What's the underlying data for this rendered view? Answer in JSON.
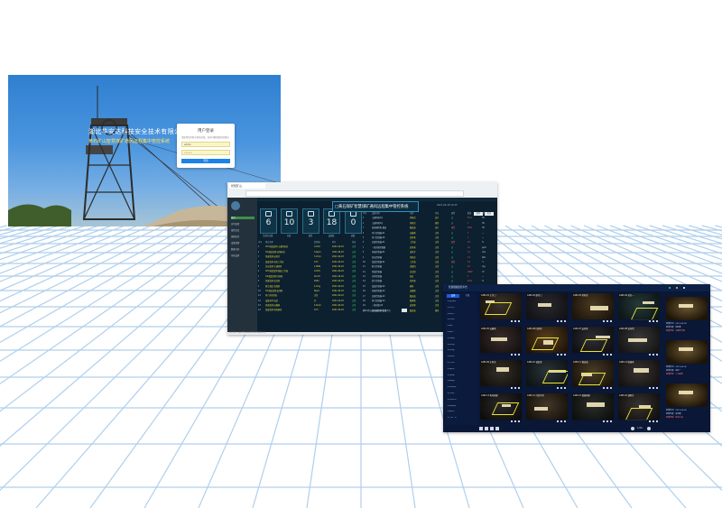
{
  "login": {
    "company": "湖北华安达科技安全技术有限公司",
    "system": "黄石矿山智慧煤矿通风远程集中管控系统",
    "card_title": "用户登录",
    "hint": "请使用您的账号登录系统，如有问题请联系管理员",
    "username_value": "admin",
    "password_value": "••••••",
    "login_button": "登录"
  },
  "dashboard": {
    "browser_tab": "智慧矿山",
    "title": "□黄石煤矿智慧煤矿通风远程集中管控系统",
    "date": "2021-06-18 10:25",
    "toggles": [
      "实时",
      "历史"
    ],
    "side_items": [
      "首页",
      "实时监测",
      "报警信息",
      "视频监控",
      "设备管理",
      "数据分析",
      "系统设置"
    ],
    "kpis": [
      {
        "value": "6",
        "label": "监测点总数"
      },
      {
        "value": "10",
        "label": "在线"
      },
      {
        "value": "3",
        "label": "报警"
      },
      {
        "value": "18",
        "label": "设备数"
      },
      {
        "value": "0",
        "label": "故障"
      }
    ],
    "left_table": {
      "headers": [
        "序号",
        "测点名称",
        "监测值",
        "时间",
        "状态"
      ],
      "rows": [
        [
          "1",
          "CH4浓度监测-主通风机房",
          "0.02%",
          "2021-06-18",
          "正常"
        ],
        [
          "2",
          "CO浓度监测-回风巷道",
          "12ppm",
          "2021-06-18",
          "正常"
        ],
        [
          "3",
          "风速监测-进风井",
          "3.2m/s",
          "2021-06-18",
          "正常"
        ],
        [
          "4",
          "温度监测-采区工作面",
          "24℃",
          "2021-06-18",
          "正常"
        ],
        [
          "5",
          "负压监测-主通风机",
          "1.8kPa",
          "2021-06-18",
          "正常"
        ],
        [
          "6",
          "CH4浓度监测-掘进工作面",
          "0.05%",
          "2021-06-18",
          "正常"
        ],
        [
          "7",
          "O2浓度监测-回风巷",
          "20.6%",
          "2021-06-18",
          "正常"
        ],
        [
          "8",
          "风量监测-总回风",
          "2600",
          "2021-06-18",
          "正常"
        ],
        [
          "9",
          "粉尘浓度-采煤机",
          "4.2mg",
          "2021-06-18",
          "正常"
        ],
        [
          "10",
          "CO浓度监测-皮带巷",
          "8ppm",
          "2021-06-18",
          "正常"
        ],
        [
          "11",
          "风门开闭状态",
          "关闭",
          "2021-06-18",
          "正常"
        ],
        [
          "12",
          "设备开停-局扇",
          "开",
          "2021-06-18",
          "正常"
        ],
        [
          "13",
          "风速监测-运输巷",
          "2.6m/s",
          "2021-06-18",
          "正常"
        ],
        [
          "14",
          "温度监测-机电硐室",
          "22℃",
          "2021-06-18",
          "正常"
        ]
      ]
    },
    "right_table": {
      "headers": [
        "序号",
        "设备名称",
        "位置",
        "状态",
        "报警",
        "数值",
        "单位"
      ],
      "rows": [
        [
          "1",
          "主通风机1号",
          "风机房",
          "运行",
          "无",
          "45.2",
          "Hz"
        ],
        [
          "2",
          "主通风机2号",
          "风机房",
          "备用",
          "无",
          "0",
          "Hz"
        ],
        [
          "3",
          "局部通风机-掘进",
          "掘进面",
          "运行",
          "报警",
          "38.6",
          "Hz"
        ],
        [
          "4",
          "风门控制器-01",
          "运输巷",
          "正常",
          "无",
          "1",
          "—"
        ],
        [
          "5",
          "风门控制器-02",
          "回风巷",
          "正常",
          "无",
          "1",
          "—"
        ],
        [
          "6",
          "瓦斯传感器-01",
          "工作面",
          "正常",
          "报警",
          "0.8",
          "%"
        ],
        [
          "7",
          "一氧化碳传感器",
          "回风巷",
          "正常",
          "无",
          "12",
          "ppm"
        ],
        [
          "8",
          "风速传感器-01",
          "进风井",
          "正常",
          "无",
          "3.2",
          "m/s"
        ],
        [
          "9",
          "负压传感器",
          "风机房",
          "正常",
          "无",
          "1.8",
          "kPa"
        ],
        [
          "10",
          "温度传感器-01",
          "工作面",
          "正常",
          "报警",
          "31",
          "℃"
        ],
        [
          "11",
          "粉尘传感器",
          "采煤机",
          "正常",
          "无",
          "4.2",
          "mg"
        ],
        [
          "12",
          "风量传感器",
          "总回风",
          "正常",
          "无",
          "2600",
          "m³"
        ],
        [
          "13",
          "开停传感器",
          "局扇",
          "正常",
          "无",
          "1",
          "—"
        ],
        [
          "14",
          "氧气传感器",
          "回风巷",
          "正常",
          "无",
          "20.6",
          "%"
        ],
        [
          "15",
          "温度传感器-02",
          "硐室",
          "正常",
          "无",
          "22",
          "℃"
        ],
        [
          "16",
          "风速传感器-02",
          "运输巷",
          "正常",
          "无",
          "2.6",
          "m/s"
        ],
        [
          "17",
          "瓦斯传感器-02",
          "掘进面",
          "正常",
          "无",
          "0.05",
          "%"
        ],
        [
          "18",
          "风门控制器-03",
          "联络巷",
          "正常",
          "无",
          "0",
          "—"
        ],
        [
          "19",
          "一氧化碳-02",
          "皮带巷",
          "正常",
          "无",
          "8",
          "ppm"
        ],
        [
          "20",
          "局部通风机-备用",
          "掘进面",
          "备用",
          "无",
          "0",
          "Hz"
        ]
      ]
    },
    "status_line": "共20条记录 每页20条 第1页",
    "footer": "技术支持：湖北华安达科技安全技术有限公司"
  },
  "video": {
    "title": "智慧视频监控平台",
    "tree_tabs": [
      "设备",
      "分组"
    ],
    "tree_items": [
      "▾ 黄石煤矿",
      "  ▸ 主井口",
      "  ▸ 副井口",
      "  ▸ 风机房",
      "  ▸ 采区一",
      "  ▸ 采区二",
      "  ▸ 运输巷",
      "  ▸ 回风巷",
      "  ▸ 皮带巷",
      "  ▸ 变电所",
      "  ▸ 水泵房",
      "  ▸ 调度室",
      "  ▸ 掘进面",
      "  ▸ 联络巷",
      "  ▸ 机电硐室",
      "  ▸ 炸药库",
      "  ▸ 井底车场",
      "  ▸ 避难硐室",
      "  ▸ 通风井",
      "  ▸ 工业广场"
    ],
    "cameras": [
      "CAM-01 主井口",
      "CAM-02 副井口",
      "CAM-03 风机房",
      "CAM-04 采区一",
      "CAM-05 运输巷",
      "CAM-06 回风巷",
      "CAM-07 皮带巷",
      "CAM-08 变电所",
      "CAM-09 水泵房",
      "CAM-10 调度室",
      "CAM-11 掘进面",
      "CAM-12 联络巷",
      "CAM-13 机电硐室",
      "CAM-14 井底车场",
      "CAM-15 避难硐室",
      "CAM-16 通风井"
    ],
    "alerts": [
      {
        "line1": "报警时间：2021-06-18",
        "line2": "报警位置：回风巷",
        "line3": "报警类型：未戴安全帽"
      },
      {
        "line1": "报警时间：2021-06-18",
        "line2": "报警位置：采区一",
        "line3": "报警类型：人员越界"
      },
      {
        "line1": "报警时间：2021-06-18",
        "line2": "报警位置：皮带巷",
        "line3": "报警类型：区域入侵"
      }
    ],
    "pager": "1/20"
  }
}
